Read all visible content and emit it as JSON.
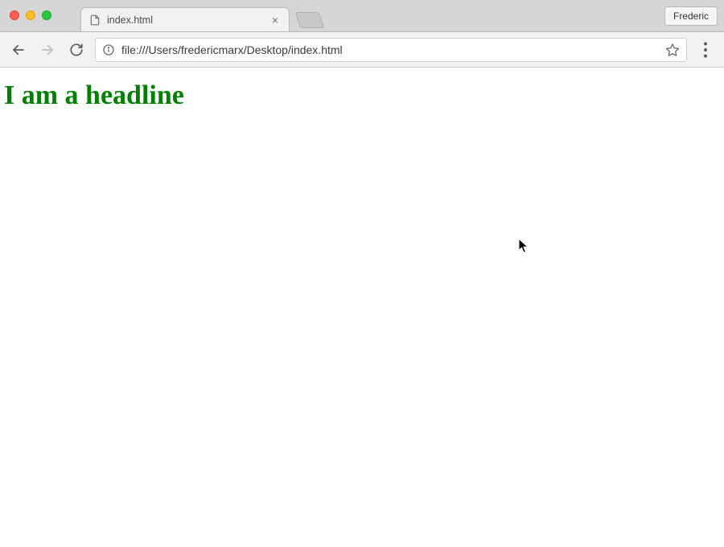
{
  "window": {
    "profile_name": "Frederic"
  },
  "tab": {
    "title": "index.html",
    "favicon": "file-icon"
  },
  "toolbar": {
    "back_enabled": true,
    "forward_enabled": false,
    "url": "file:///Users/fredericmarx/Desktop/index.html"
  },
  "page": {
    "headline": "I am a headline",
    "headline_color": "#008000"
  }
}
